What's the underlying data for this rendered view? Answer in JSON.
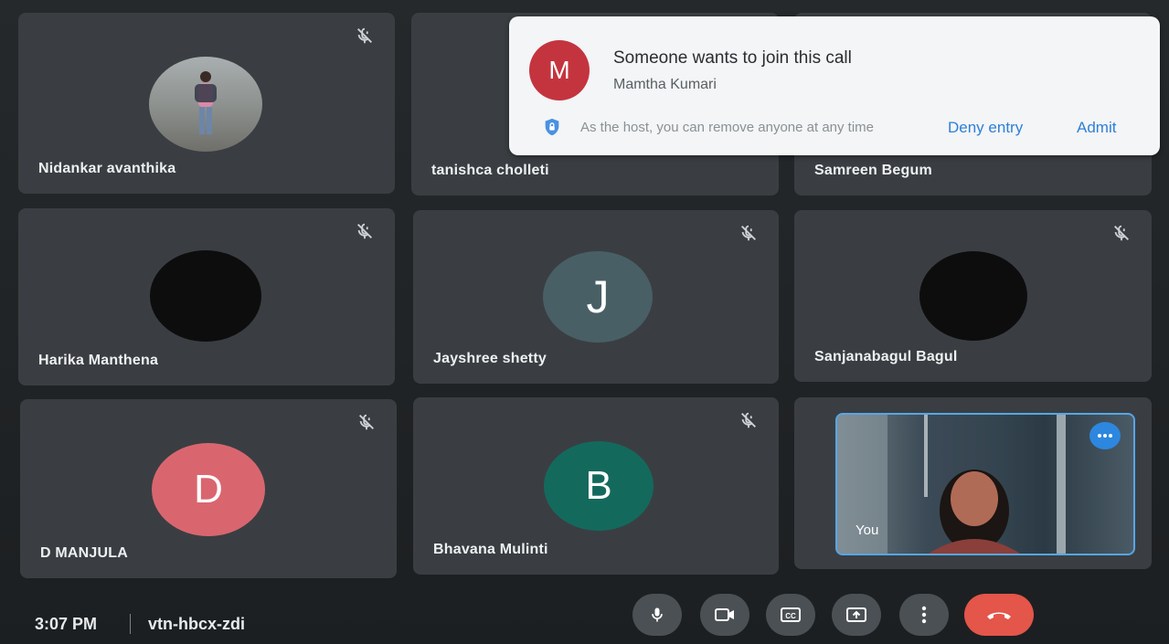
{
  "notification": {
    "avatar_letter": "M",
    "avatar_color": "#c4343f",
    "title": "Someone wants to join this call",
    "requester": "Mamtha Kumari",
    "host_note": "As the host, you can remove anyone at any time",
    "deny_label": "Deny entry",
    "admit_label": "Admit",
    "shield_icon": "shield-lock-icon"
  },
  "participants": [
    {
      "name": "Nidankar avanthika",
      "muted": true,
      "avatar": "photo"
    },
    {
      "name": "tanishca cholleti",
      "muted": false,
      "avatar": "none"
    },
    {
      "name": "Samreen Begum",
      "muted": false,
      "avatar": "none"
    },
    {
      "name": "Harika Manthena",
      "muted": true,
      "avatar": "dark"
    },
    {
      "name": "Jayshree shetty",
      "muted": true,
      "avatar_letter": "J",
      "avatar_color": "#485f66"
    },
    {
      "name": "Sanjanabagul Bagul",
      "muted": true,
      "avatar": "dark"
    },
    {
      "name": "D MANJULA",
      "muted": true,
      "avatar_letter": "D",
      "avatar_color": "#d9666f"
    },
    {
      "name": "Bhavana Mulinti",
      "muted": true,
      "avatar_letter": "B",
      "avatar_color": "#14695d"
    }
  ],
  "self_view": {
    "label": "You",
    "more_icon": "more-horizontal-icon"
  },
  "bottom_bar": {
    "time": "3:07 PM",
    "meeting_code": "vtn-hbcx-zdi",
    "controls": [
      "mic-icon",
      "camera-icon",
      "captions-icon",
      "present-icon",
      "more-vertical-icon",
      "end-call-icon"
    ]
  },
  "colors": {
    "accent": "#2f7fd8",
    "end_call": "#e4554a",
    "tile": "#3a3e42"
  }
}
